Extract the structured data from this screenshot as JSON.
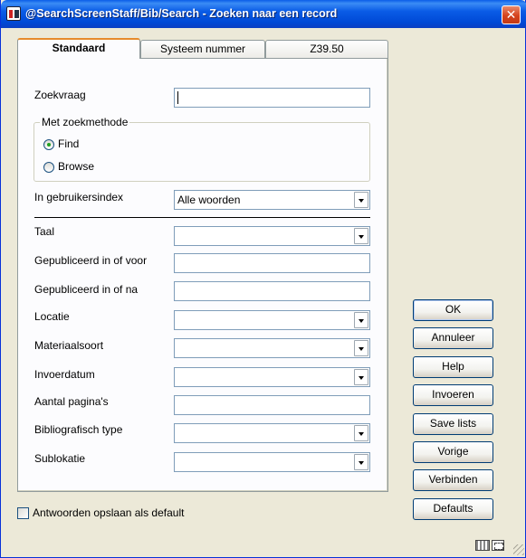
{
  "window": {
    "title": "@SearchScreenStaff/Bib/Search - Zoeken naar een record",
    "close_icon": "close-icon",
    "app_icon": "app-icon"
  },
  "tabs": [
    {
      "label": "Standaard",
      "active": true
    },
    {
      "label": "Systeem nummer",
      "active": false
    },
    {
      "label": "Z39.50",
      "active": false
    }
  ],
  "form": {
    "zoekvraag": {
      "label": "Zoekvraag",
      "value": ""
    },
    "methode": {
      "legend": "Met zoekmethode",
      "options": [
        {
          "label": "Find",
          "checked": true
        },
        {
          "label": "Browse",
          "checked": false
        }
      ]
    },
    "gebruikersindex": {
      "label": "In gebruikersindex",
      "value": "Alle woorden"
    },
    "taal": {
      "label": "Taal",
      "value": ""
    },
    "gepubliceerd_voor": {
      "label": "Gepubliceerd in of voor",
      "value": ""
    },
    "gepubliceerd_na": {
      "label": "Gepubliceerd in of na",
      "value": ""
    },
    "locatie": {
      "label": "Locatie",
      "value": ""
    },
    "materiaalsoort": {
      "label": "Materiaalsoort",
      "value": ""
    },
    "invoerdatum": {
      "label": "Invoerdatum",
      "value": ""
    },
    "aantal_paginas": {
      "label": "Aantal pagina's",
      "value": ""
    },
    "bibliografisch_type": {
      "label": "Bibliografisch type",
      "value": ""
    },
    "sublokatie": {
      "label": "Sublokatie",
      "value": ""
    }
  },
  "buttons": {
    "ok": "OK",
    "annuleer": "Annuleer",
    "help": "Help",
    "invoeren": "Invoeren",
    "save_lists": "Save lists",
    "vorige": "Vorige",
    "verbinden": "Verbinden",
    "defaults": "Defaults"
  },
  "save_default": {
    "label": "Antwoorden opslaan als default",
    "checked": false
  },
  "status": {
    "keyboard_icon": "keyboard-icon",
    "resize_icon": "resize-icon"
  },
  "colors": {
    "titlebar": "#0a5ce6",
    "window_bg": "#ece9d8",
    "tab_accent": "#e68b2c"
  }
}
